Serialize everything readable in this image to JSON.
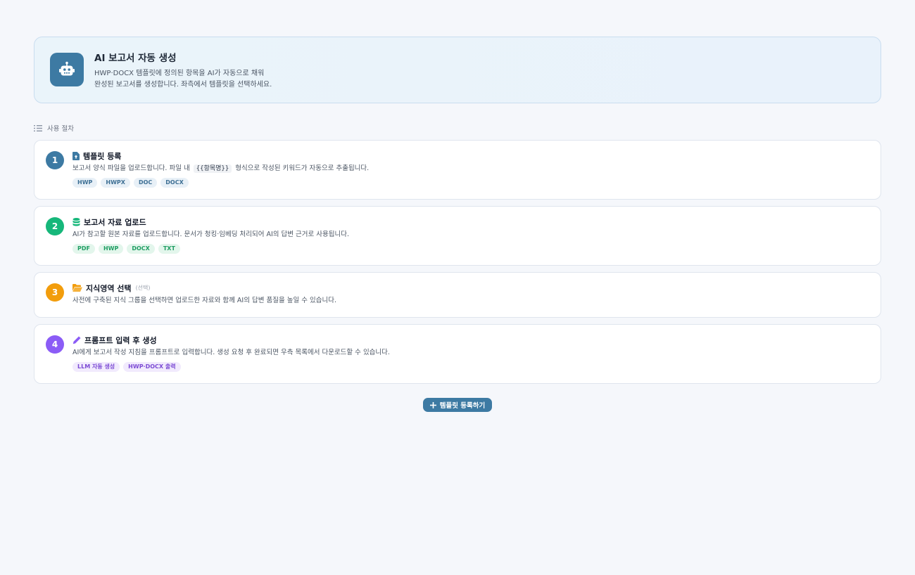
{
  "hero": {
    "title": "AI 보고서 자동 생성",
    "desc_line1": "HWP·DOCX 템플릿에 정의된 항목을 AI가 자동으로 채워",
    "desc_line2": "완성된 보고서를 생성합니다. 좌측에서 템플릿을 선택하세요.",
    "icon": "robot-icon"
  },
  "section": {
    "label": "사용 절차",
    "icon": "list-ordered-icon"
  },
  "steps": [
    {
      "number": "1",
      "color": "#3d7aa3",
      "icon": "file-upload-icon",
      "title": "템플릿 등록",
      "desc_before": "보고서 양식 파일을 업로드합니다. 파일 내",
      "code": "{{항목명}}",
      "desc_after": "형식으로 작성된 키워드가 자동으로 추출됩니다.",
      "tags": [
        "HWP",
        "HWPX",
        "DOC",
        "DOCX"
      ]
    },
    {
      "number": "2",
      "color": "#16b77a",
      "icon": "database-icon",
      "title": "보고서 자료 업로드",
      "desc": "AI가 참고할 원본 자료를 업로드합니다. 문서가 청킹·임베딩 처리되어 AI의 답변 근거로 사용됩니다.",
      "tags": [
        "PDF",
        "HWP",
        "DOCX",
        "TXT"
      ]
    },
    {
      "number": "3",
      "color": "#f29d0c",
      "icon": "folder-open-icon",
      "title": "지식영역 선택",
      "optional": "(선택)",
      "desc": "사전에 구축된 지식 그룹을 선택하면 업로드한 자료와 함께 AI의 답변 품질을 높일 수 있습니다."
    },
    {
      "number": "4",
      "color": "#8b5cf6",
      "icon": "pencil-icon",
      "title": "프롬프트 입력 후 생성",
      "desc": "AI에게 보고서 작성 지침을 프롬프트로 입력합니다. 생성 요청 후 완료되면 우측 목록에서 다운로드할 수 있습니다.",
      "tags": [
        "LLM 자동 생성",
        "HWP·DOCX 출력"
      ]
    }
  ],
  "cta": {
    "label": "템플릿 등록하기",
    "icon": "plus-icon"
  }
}
